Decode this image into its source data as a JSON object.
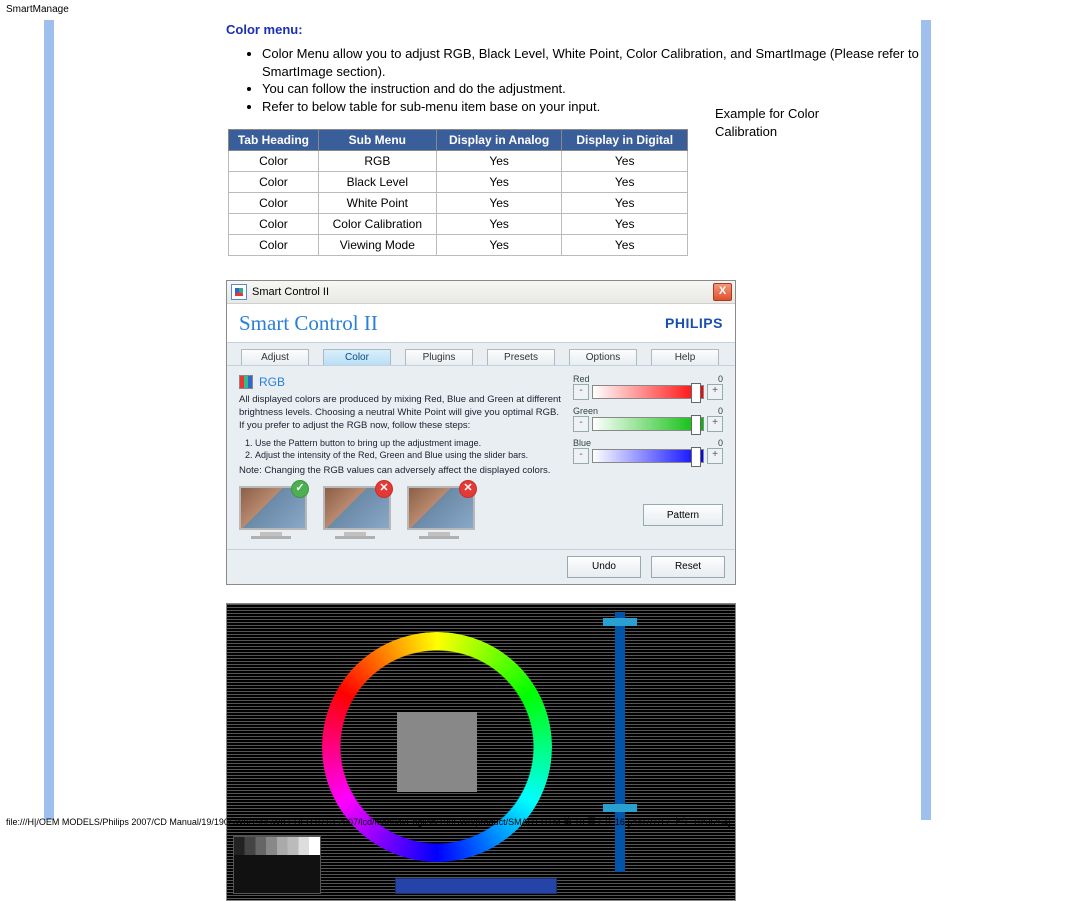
{
  "header_small": "SmartManage",
  "section_title": "Color menu:",
  "bullets": [
    "Color Menu allow you to adjust RGB, Black Level, White Point, Color Calibration, and SmartImage (Please refer to SmartImage section).",
    "You can follow the instruction and do the adjustment.",
    "Refer to below table for sub-menu item base on your input."
  ],
  "right_note": "Example for Color Calibration",
  "table": {
    "headers": [
      "Tab Heading",
      "Sub Menu",
      "Display in Analog",
      "Display in Digital"
    ],
    "rows": [
      [
        "Color",
        "RGB",
        "Yes",
        "Yes"
      ],
      [
        "Color",
        "Black Level",
        "Yes",
        "Yes"
      ],
      [
        "Color",
        "White Point",
        "Yes",
        "Yes"
      ],
      [
        "Color",
        "Color Calibration",
        "Yes",
        "Yes"
      ],
      [
        "Color",
        "Viewing Mode",
        "Yes",
        "Yes"
      ]
    ]
  },
  "sc": {
    "titlebar": "Smart Control II",
    "close": "X",
    "header_title": "Smart Control II",
    "brand": "PHILIPS",
    "tabs": [
      "Adjust",
      "Color",
      "Plugins",
      "Presets",
      "Options",
      "Help"
    ],
    "active_tab": 1,
    "rgb_label": "RGB",
    "desc1": "All displayed colors are produced by mixing Red, Blue and Green at different brightness levels. Choosing a neutral White Point will give you optimal RGB. If you prefer to adjust the RGB now, follow these steps:",
    "steps": [
      "Use the Pattern button to bring up the adjustment image.",
      "Adjust the intensity of the Red, Green and Blue using the slider bars."
    ],
    "note": "Note: Changing the RGB values can adversely affect the displayed colors.",
    "sliders": [
      {
        "label": "Red",
        "value": "0"
      },
      {
        "label": "Green",
        "value": "0"
      },
      {
        "label": "Blue",
        "value": "0"
      }
    ],
    "minus": "-",
    "plus": "+",
    "pattern_btn": "Pattern",
    "undo": "Undo",
    "reset": "Reset",
    "thumb_ok": "✓",
    "thumb_no": "✕"
  },
  "footer": "file:///H|/OEM MODELS/Philips 2007/CD Manual/19/190SW8/190SW8 EDFU 0713-2007/lcd/manual/English/190SW8/product/SMART.HTM 第 10 頁 / 共 16  [2007/7/17 上午 10:36:54]"
}
